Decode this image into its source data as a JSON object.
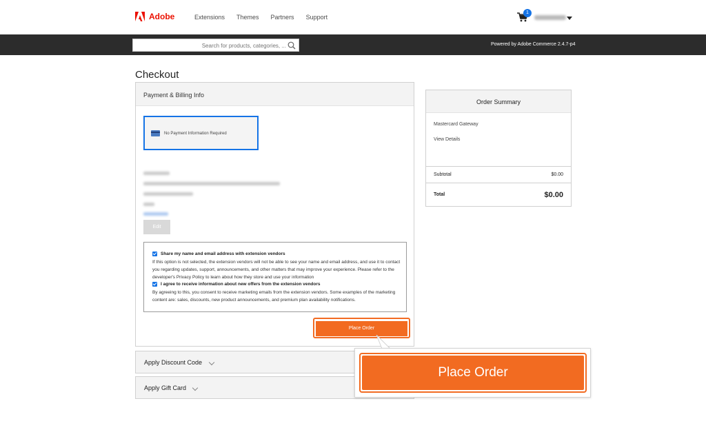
{
  "header": {
    "logo_text": "Adobe",
    "nav": [
      "Extensions",
      "Themes",
      "Partners",
      "Support"
    ],
    "cart_count": "1"
  },
  "search": {
    "placeholder": "Search for products, categories, ..."
  },
  "powered_by": "Powered by Adobe Commerce 2.4.7-p4",
  "page_title": "Checkout",
  "payment": {
    "section_title": "Payment & Billing Info",
    "option_label": "No Payment Information Required",
    "edit_label": "Edit"
  },
  "consent": {
    "share_label": "Share my name and email address with extension vendors",
    "share_text": "If this option is not selected, the extension vendors will not be able to see your name and email address, and use it to contact you regarding updates, support, announcements, and other matters that may improve your experience. Please refer to the developer's Privacy Policy to learn about how they store and use your information",
    "offers_label": "I agree to receive information about new offers from the extension vendors",
    "offers_text": "By agreeing to this, you consent to receive marketing emails from the extension vendors. Some examples of the marketing content are: sales, discounts, new product announcements, and premium plan availability notifications."
  },
  "place_order_label": "Place Order",
  "discount_label": "Apply Discount Code",
  "gift_card_label": "Apply Gift Card",
  "summary": {
    "title": "Order Summary",
    "item_name": "Mastercard Gateway",
    "view_details": "View Details",
    "subtotal_label": "Subtotal",
    "subtotal_value": "$0.00",
    "total_label": "Total",
    "total_value": "$0.00"
  },
  "callout_label": "Place Order",
  "colors": {
    "accent_orange": "#f26b21",
    "adobe_red": "#eb1000",
    "selection_blue": "#1473e6",
    "bar_dark": "#2c2c2c"
  }
}
